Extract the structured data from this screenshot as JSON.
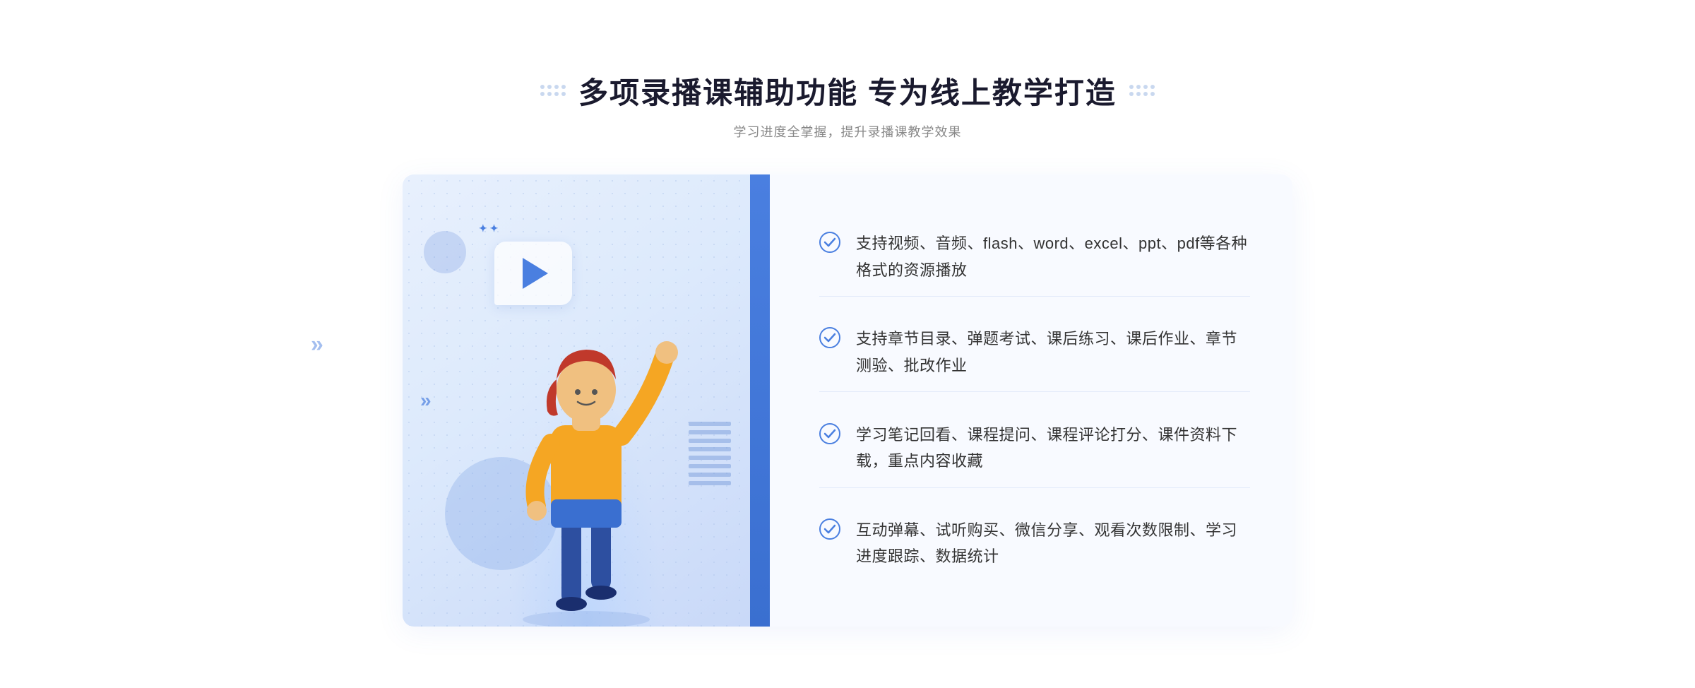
{
  "header": {
    "title": "多项录播课辅助功能 专为线上教学打造",
    "subtitle": "学习进度全掌握，提升录播课教学效果"
  },
  "features": [
    {
      "id": 1,
      "text": "支持视频、音频、flash、word、excel、ppt、pdf等各种格式的资源播放"
    },
    {
      "id": 2,
      "text": "支持章节目录、弹题考试、课后练习、课后作业、章节测验、批改作业"
    },
    {
      "id": 3,
      "text": "学习笔记回看、课程提问、课程评论打分、课件资料下载，重点内容收藏"
    },
    {
      "id": 4,
      "text": "互动弹幕、试听购买、微信分享、观看次数限制、学习进度跟踪、数据统计"
    }
  ],
  "icons": {
    "check": "check-circle-icon",
    "play": "play-icon",
    "arrow": "chevron-right-icon"
  },
  "colors": {
    "primary": "#4a7fe0",
    "primaryLight": "#e8f0fd",
    "text": "#333333",
    "subtitle": "#888888",
    "border": "#b4c8f0"
  }
}
